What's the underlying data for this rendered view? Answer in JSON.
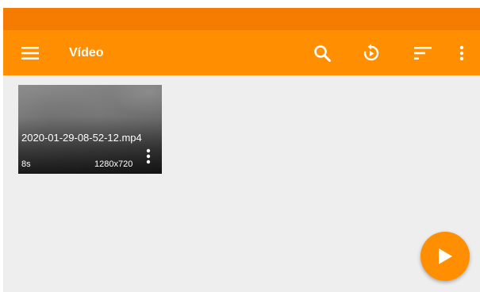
{
  "app_bar": {
    "title": "Vídeo",
    "icons": [
      "menu-icon",
      "search-icon",
      "replay-icon",
      "sort-icon",
      "more-vert-icon"
    ]
  },
  "videos": [
    {
      "name": "2020-01-29-08-52-12.mp4",
      "duration": "8s",
      "resolution": "1280x720"
    }
  ],
  "fab": {
    "icon": "play-icon"
  },
  "colors": {
    "status_bar": "#f57c00",
    "app_bar": "#ff8f00",
    "background": "#eeeeee",
    "fab": "#ff8f00"
  }
}
